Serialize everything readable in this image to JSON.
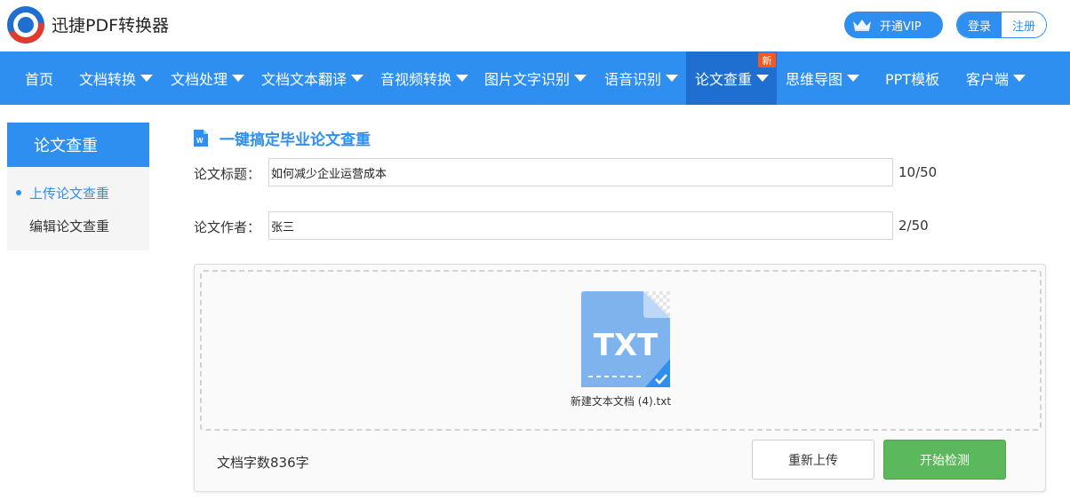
{
  "header": {
    "app_title": "迅捷PDF转换器",
    "vip_label": "开通VIP",
    "login_label": "登录",
    "register_label": "注册"
  },
  "nav": {
    "items": [
      {
        "label": "首页",
        "has_dropdown": false
      },
      {
        "label": "文档转换",
        "has_dropdown": true
      },
      {
        "label": "文档处理",
        "has_dropdown": true
      },
      {
        "label": "文档文本翻译",
        "has_dropdown": true
      },
      {
        "label": "音视频转换",
        "has_dropdown": true
      },
      {
        "label": "图片文字识别",
        "has_dropdown": true
      },
      {
        "label": "语音识别",
        "has_dropdown": true
      },
      {
        "label": "论文查重",
        "has_dropdown": true,
        "active": true
      },
      {
        "label": "思维导图",
        "has_dropdown": true
      },
      {
        "label": "PPT模板",
        "has_dropdown": false
      },
      {
        "label": "客户端",
        "has_dropdown": true
      }
    ],
    "new_badge": "新"
  },
  "sidebar": {
    "title": "论文查重",
    "items": [
      {
        "label": "上传论文查重",
        "active": true
      },
      {
        "label": "编辑论文查重",
        "active": false
      }
    ]
  },
  "main": {
    "section_title": "一键搞定毕业论文查重",
    "title_field": {
      "label": "论文标题：",
      "value": "如何减少企业运营成本",
      "count": "10/50"
    },
    "author_field": {
      "label": "论文作者：",
      "value": "张三",
      "count": "2/50"
    },
    "upload": {
      "file_type": "TXT",
      "file_name": "新建文本文档 (4).txt",
      "word_count": "文档字数836字",
      "reupload_label": "重新上传",
      "start_label": "开始检测"
    }
  },
  "colors": {
    "primary": "#2f8ff0",
    "nav_active": "#1e6fcf",
    "badge": "#f25a1f",
    "start_button": "#5cb85c"
  },
  "icons": [
    "app-logo-icon",
    "crown-icon",
    "chevron-down-icon",
    "word-doc-icon",
    "txt-file-icon",
    "check-icon"
  ]
}
